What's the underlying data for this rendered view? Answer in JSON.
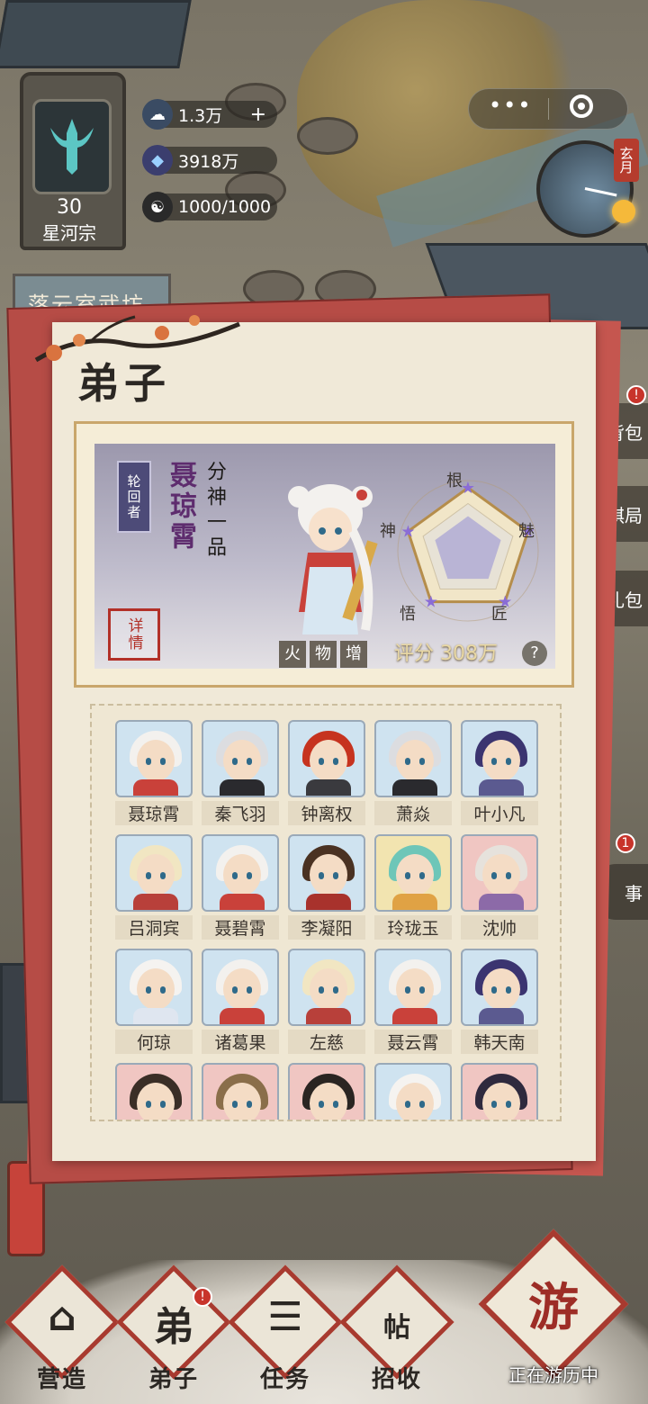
{
  "hud": {
    "sect_level": "30",
    "sect_name": "星河宗",
    "resources": [
      {
        "icon": "spirit-stone-bag-icon",
        "value": "1.3万",
        "has_plus": true
      },
      {
        "icon": "crystal-icon",
        "value": "3918万",
        "has_plus": false
      },
      {
        "icon": "yin-yang-icon",
        "value": "1000/1000",
        "has_plus": false
      }
    ],
    "capsule_more": "•••",
    "clock_month": "玄月",
    "left_sign": "落云室武坊"
  },
  "side_buttons": {
    "bag": "背包",
    "chess": "回棋局",
    "gift": "礼包",
    "event": "事",
    "bag_badge": "!",
    "event_badge": "1"
  },
  "panel": {
    "title": "弟子",
    "featured": {
      "rank_tag": "轮回者",
      "name": "聂琼霄",
      "realm": "分神一品",
      "detail_button": "详情",
      "tags": [
        "火",
        "物",
        "增"
      ],
      "score_label": "评分",
      "score_value": "308万",
      "help": "?",
      "radar": {
        "axes": [
          "根",
          "魅",
          "匠",
          "悟",
          "神"
        ],
        "values": [
          0.55,
          0.55,
          0.55,
          0.55,
          0.55
        ]
      }
    },
    "roster": [
      {
        "name": "聂琼霄",
        "bg": "#cfe3f0",
        "hair": "#f3f1ee",
        "body": "#c9413a"
      },
      {
        "name": "秦飞羽",
        "bg": "#cfe3f0",
        "hair": "#dcdde0",
        "body": "#2a2a2e"
      },
      {
        "name": "钟离权",
        "bg": "#cfe3f0",
        "hair": "#c6331f",
        "body": "#3a3a3e"
      },
      {
        "name": "萧焱",
        "bg": "#cfe3f0",
        "hair": "#dcdde0",
        "body": "#2a2a2e"
      },
      {
        "name": "叶小凡",
        "bg": "#cfe3f0",
        "hair": "#3b3470",
        "body": "#5b5a90"
      },
      {
        "name": "吕洞宾",
        "bg": "#cfe3f0",
        "hair": "#f1e6c2",
        "body": "#b8403a"
      },
      {
        "name": "聂碧霄",
        "bg": "#cfe3f0",
        "hair": "#f3f1ee",
        "body": "#c9413a"
      },
      {
        "name": "李凝阳",
        "bg": "#cfe3f0",
        "hair": "#4a3222",
        "body": "#a8322c"
      },
      {
        "name": "玲珑玉",
        "bg": "#f2e4b0",
        "hair": "#6ec6b8",
        "body": "#e0a244"
      },
      {
        "name": "沈帅",
        "bg": "#f0c6c2",
        "hair": "#e6e2dc",
        "body": "#8c6aa8"
      },
      {
        "name": "何琼",
        "bg": "#cfe3f0",
        "hair": "#f5f3f0",
        "body": "#dfe6f0"
      },
      {
        "name": "诸葛果",
        "bg": "#cfe3f0",
        "hair": "#f3f1ee",
        "body": "#c9413a"
      },
      {
        "name": "左慈",
        "bg": "#cfe3f0",
        "hair": "#f1e6c2",
        "body": "#b8403a"
      },
      {
        "name": "聂云霄",
        "bg": "#cfe3f0",
        "hair": "#f3f1ee",
        "body": "#c9413a"
      },
      {
        "name": "韩天南",
        "bg": "#cfe3f0",
        "hair": "#3b3470",
        "body": "#5b5a90"
      },
      {
        "name": "",
        "bg": "#f0c6c2",
        "hair": "#3a2e26",
        "body": "#8a7a64"
      },
      {
        "name": "",
        "bg": "#f0c6c2",
        "hair": "#8a6e4a",
        "body": "#8a7a64"
      },
      {
        "name": "",
        "bg": "#f0c6c2",
        "hair": "#2a2522",
        "body": "#8a7a64"
      },
      {
        "name": "",
        "bg": "#cfe3f0",
        "hair": "#f5f3f0",
        "body": "#dfe6f0"
      },
      {
        "name": "",
        "bg": "#f0c6c2",
        "hair": "#2f2a3e",
        "body": "#8a7a64"
      }
    ]
  },
  "nav": {
    "items": [
      {
        "label": "营造",
        "glyph": "⌂"
      },
      {
        "label": "弟子",
        "glyph": "弟"
      },
      {
        "label": "任务",
        "glyph": "☰"
      },
      {
        "label": "招收",
        "glyph": "帖"
      }
    ],
    "disciple_badge": "!",
    "travel_label": "正在游历中",
    "travel_glyph": "游"
  },
  "colors": {
    "accent_red": "#a83a2f",
    "panel_bg": "#f0e9d8",
    "name_purple": "#5e2c6e"
  }
}
